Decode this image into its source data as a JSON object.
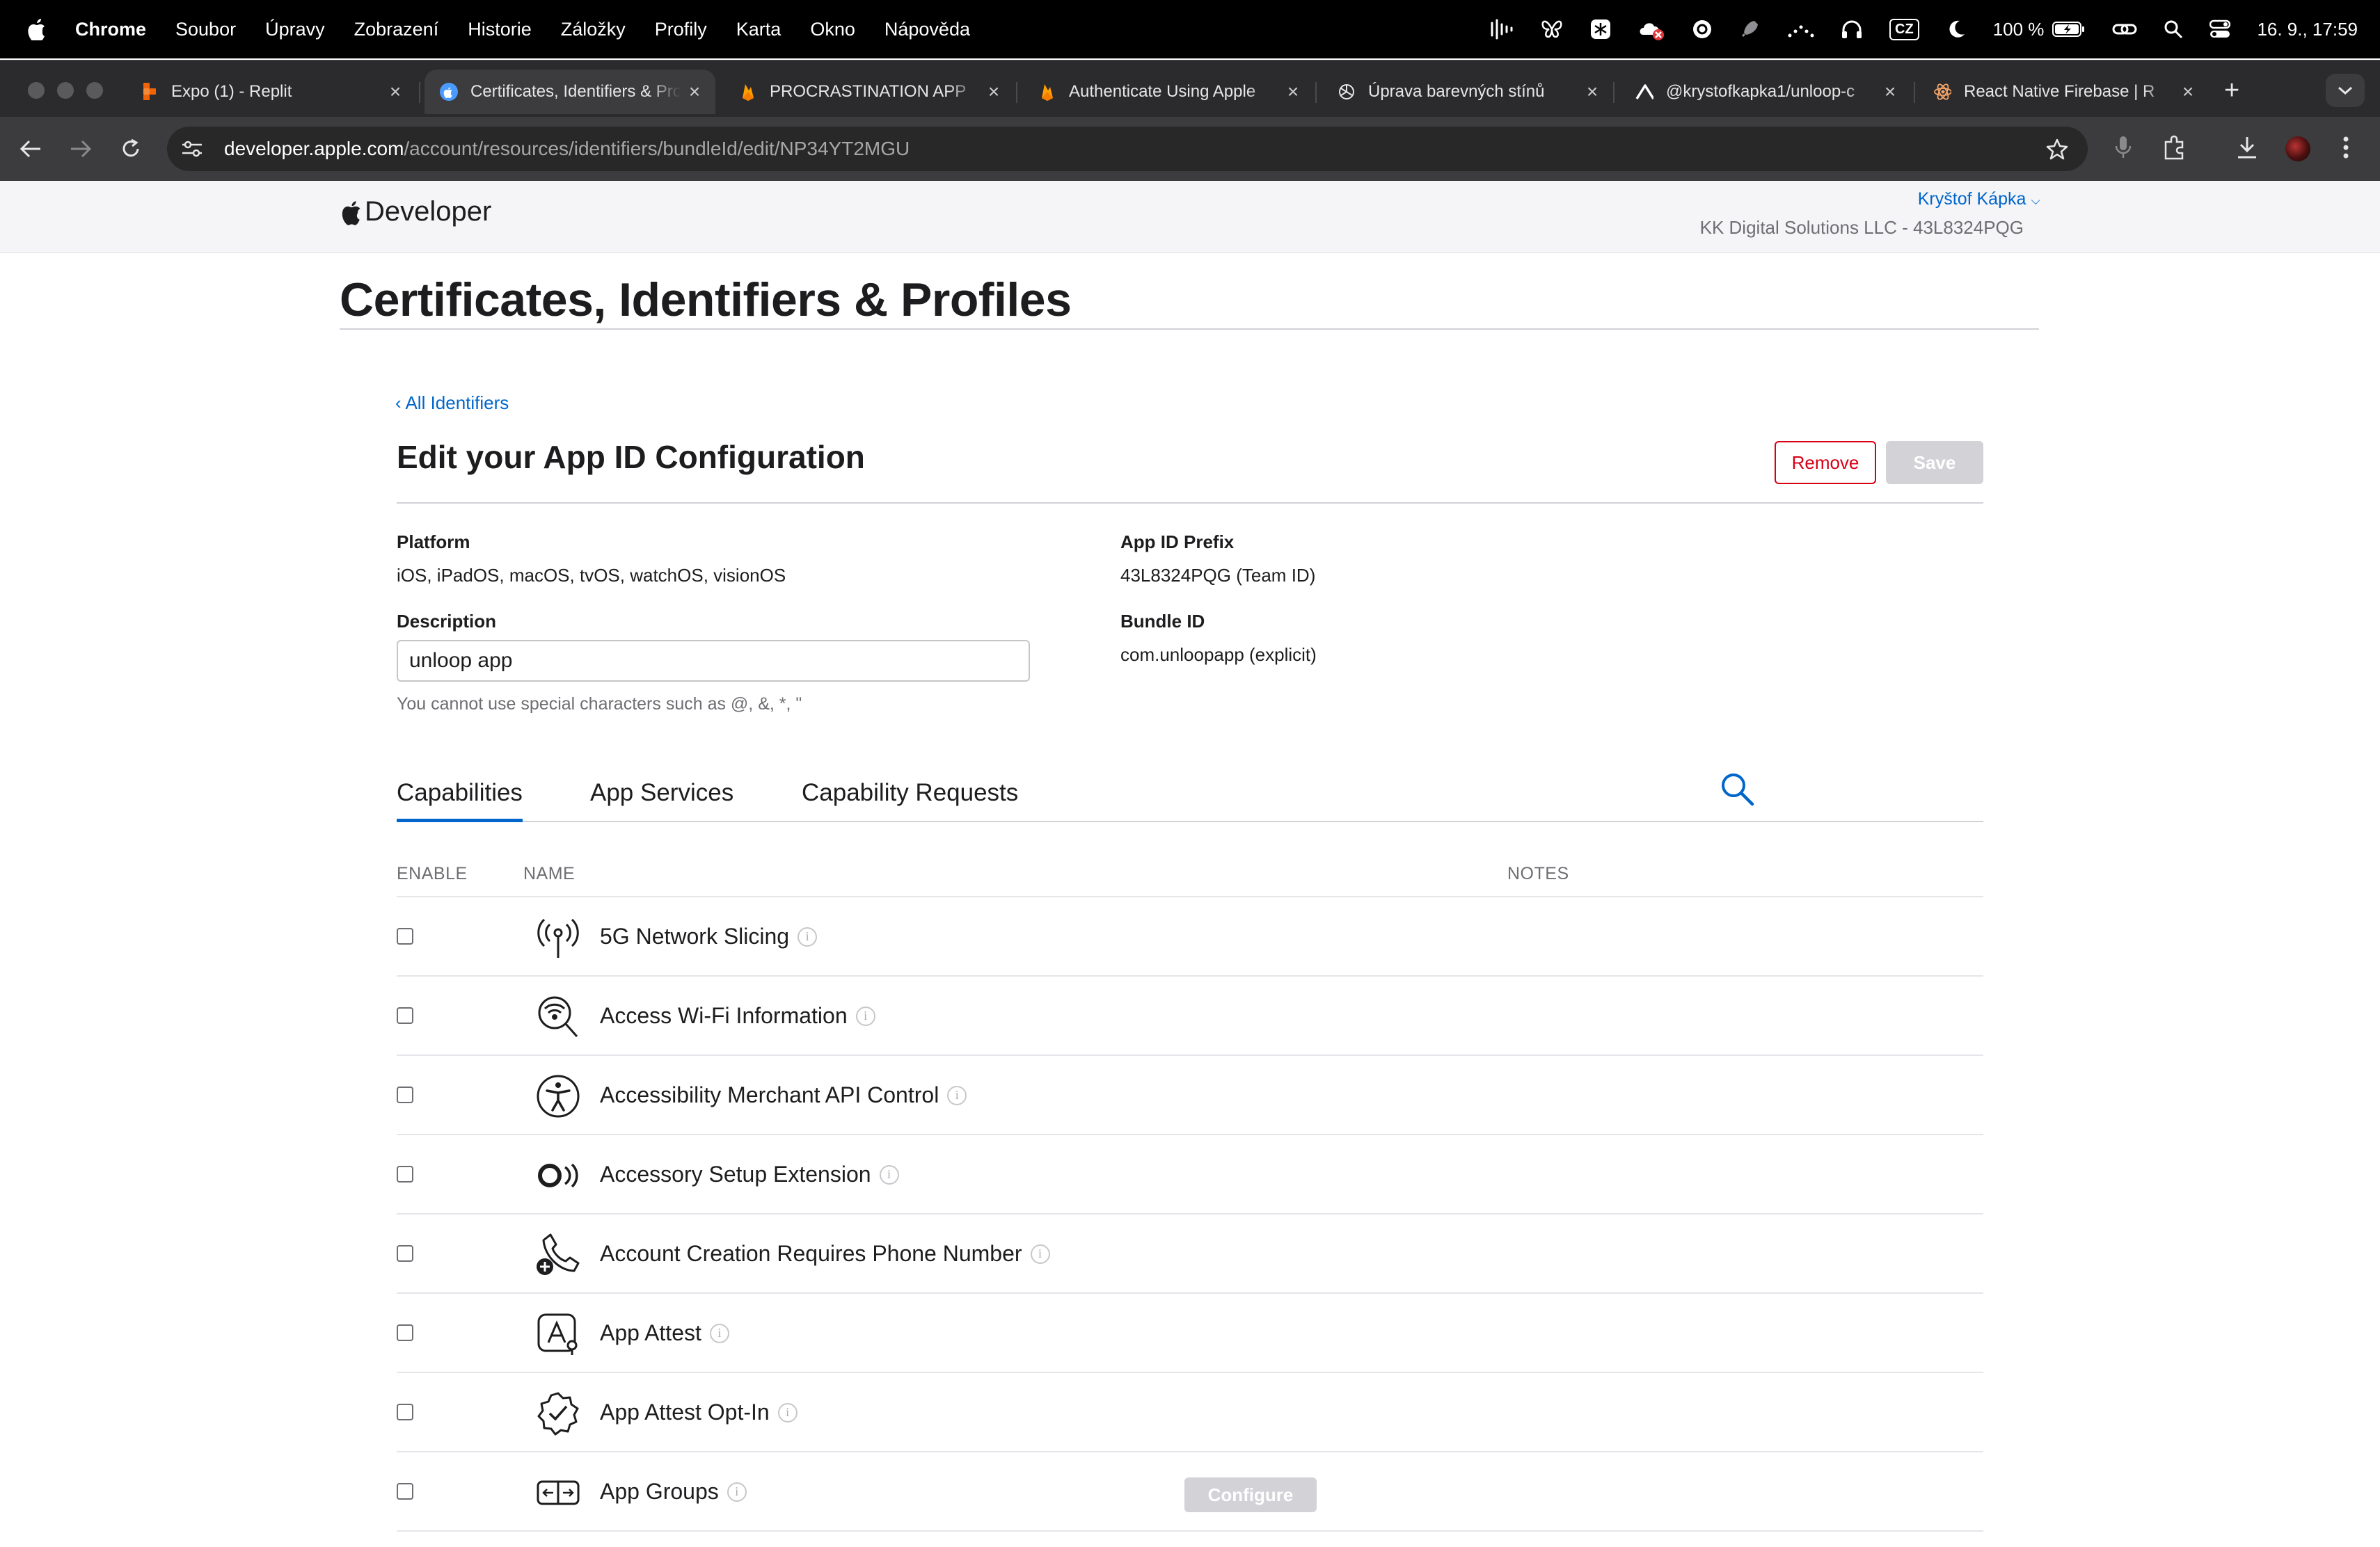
{
  "menubar": {
    "app_name": "Chrome",
    "items": [
      "Soubor",
      "Úpravy",
      "Zobrazení",
      "Historie",
      "Záložky",
      "Profily",
      "Karta",
      "Okno",
      "Nápověda"
    ],
    "battery": "100 %",
    "keyboard": "CZ",
    "clock": "16. 9., 17:59"
  },
  "tabs": [
    {
      "title": "Expo (1) - Replit",
      "icon": "replit-icon"
    },
    {
      "title": "Certificates, Identifiers & Profiles",
      "icon": "apple-developer-icon",
      "active": true
    },
    {
      "title": "PROCRASTINATION APP",
      "icon": "firebase-icon"
    },
    {
      "title": "Authenticate Using Apple",
      "icon": "firebase-icon"
    },
    {
      "title": "Úprava barevných stínů",
      "icon": "chatgpt-icon"
    },
    {
      "title": "@krystofkapka1/unloop-c",
      "icon": "expo-icon"
    },
    {
      "title": "React Native Firebase | R",
      "icon": "react-icon"
    }
  ],
  "address_bar": {
    "host": "developer.apple.com",
    "path": "/account/resources/identifiers/bundleId/edit/NP34YT2MGU"
  },
  "header": {
    "logo_text": "Developer",
    "account_name": "Kryštof Kápka",
    "team": "KK Digital Solutions LLC - 43L8324PQG"
  },
  "page_title": "Certificates, Identifiers & Profiles",
  "back_link": "‹ All Identifiers",
  "section_title": "Edit your App ID Configuration",
  "buttons": {
    "remove": "Remove",
    "save": "Save"
  },
  "fields": {
    "platform_label": "Platform",
    "platform_value": "iOS, iPadOS, macOS, tvOS, watchOS, visionOS",
    "prefix_label": "App ID Prefix",
    "prefix_value": "43L8324PQG (Team ID)",
    "description_label": "Description",
    "description_value": "unloop app",
    "description_hint": "You cannot use special characters such as @, &, *, \"",
    "bundle_label": "Bundle ID",
    "bundle_value": "com.unloopapp (explicit)"
  },
  "content_tabs": [
    "Capabilities",
    "App Services",
    "Capability Requests"
  ],
  "table": {
    "headers": {
      "enable": "ENABLE",
      "name": "NAME",
      "notes": "NOTES"
    },
    "rows": [
      {
        "name": "5G Network Slicing",
        "icon": "antenna-icon",
        "enabled": false
      },
      {
        "name": "Access Wi-Fi Information",
        "icon": "wifi-search-icon",
        "enabled": false
      },
      {
        "name": "Accessibility Merchant API Control",
        "icon": "accessibility-icon",
        "enabled": false
      },
      {
        "name": "Accessory Setup Extension",
        "icon": "accessory-icon",
        "enabled": false
      },
      {
        "name": "Account Creation Requires Phone Number",
        "icon": "phone-plus-icon",
        "enabled": false
      },
      {
        "name": "App Attest",
        "icon": "app-attest-icon",
        "enabled": false
      },
      {
        "name": "App Attest Opt-In",
        "icon": "verified-badge-icon",
        "enabled": false
      },
      {
        "name": "App Groups",
        "icon": "app-groups-icon",
        "enabled": false,
        "action": "Configure"
      }
    ]
  },
  "colors": {
    "link": "#0066cc",
    "danger": "#d70015",
    "disabled": "#d2d2d7"
  }
}
